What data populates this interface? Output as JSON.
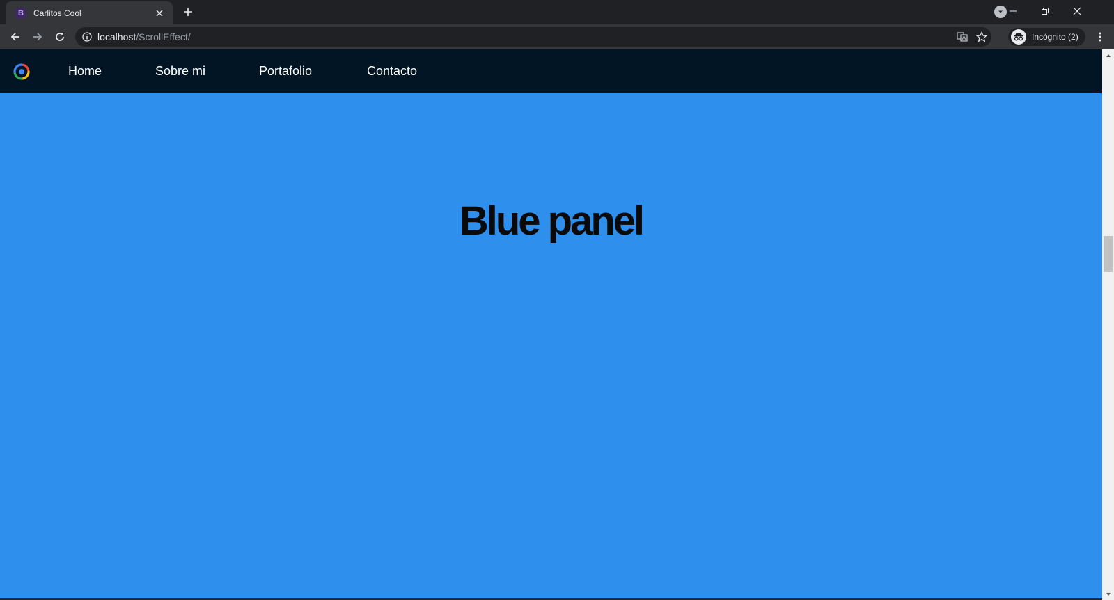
{
  "browser": {
    "tab": {
      "favicon_letter": "B",
      "title": "Carlitos Cool"
    },
    "url": {
      "host": "localhost",
      "path": "/ScrollEffect/"
    },
    "profile": {
      "label": "Incógnito (2)"
    }
  },
  "page": {
    "nav": {
      "items": [
        {
          "label": "Home"
        },
        {
          "label": "Sobre mi"
        },
        {
          "label": "Portafolio"
        },
        {
          "label": "Contacto"
        }
      ]
    },
    "panel": {
      "title": "Blue panel",
      "background": "#2e8fec"
    },
    "navbar_background": "#011524"
  }
}
